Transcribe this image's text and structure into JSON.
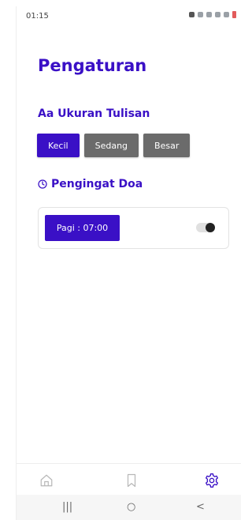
{
  "status_bar": {
    "time": "01:15"
  },
  "page": {
    "title": "Pengaturan"
  },
  "font_size": {
    "title": "Aa Ukuran Tulisan",
    "options": [
      {
        "label": "Kecil",
        "active": true
      },
      {
        "label": "Sedang",
        "active": false
      },
      {
        "label": "Besar",
        "active": false
      }
    ]
  },
  "reminder": {
    "title": "Pengingat Doa",
    "icon": "clock-icon",
    "item": {
      "label": "Pagi : 07:00",
      "enabled": true
    }
  },
  "bottom_nav": {
    "items": [
      {
        "icon": "home-icon"
      },
      {
        "icon": "bookmark-icon"
      },
      {
        "icon": "settings-icon",
        "active": true
      }
    ]
  },
  "system_nav": {
    "recents": "|||",
    "home": "○",
    "back": "<"
  },
  "colors": {
    "accent": "#3a10c6",
    "inactive_button": "#6b6b6b"
  }
}
